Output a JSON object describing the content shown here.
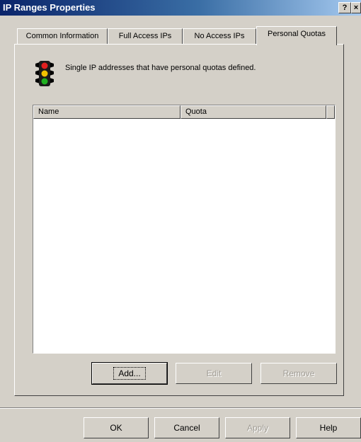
{
  "window": {
    "title": "IP Ranges Properties",
    "help_glyph": "?",
    "close_glyph": "×"
  },
  "tabs": [
    {
      "label": "Common Information"
    },
    {
      "label": "Full Access IPs"
    },
    {
      "label": "No Access IPs"
    },
    {
      "label": "Personal Quotas",
      "active": true
    }
  ],
  "page": {
    "icon": "traffic-light-icon",
    "description": "Single IP addresses that have personal quotas defined.",
    "columns": [
      "Name",
      "Quota"
    ],
    "rows": [],
    "buttons": {
      "add": "Add...",
      "edit": "Edit",
      "remove": "Remove"
    }
  },
  "footer": {
    "ok": "OK",
    "cancel": "Cancel",
    "apply": "Apply",
    "help": "Help"
  },
  "colors": {
    "face": "#d4d0c8",
    "title_start": "#0a246a",
    "title_end": "#a6caf0"
  }
}
